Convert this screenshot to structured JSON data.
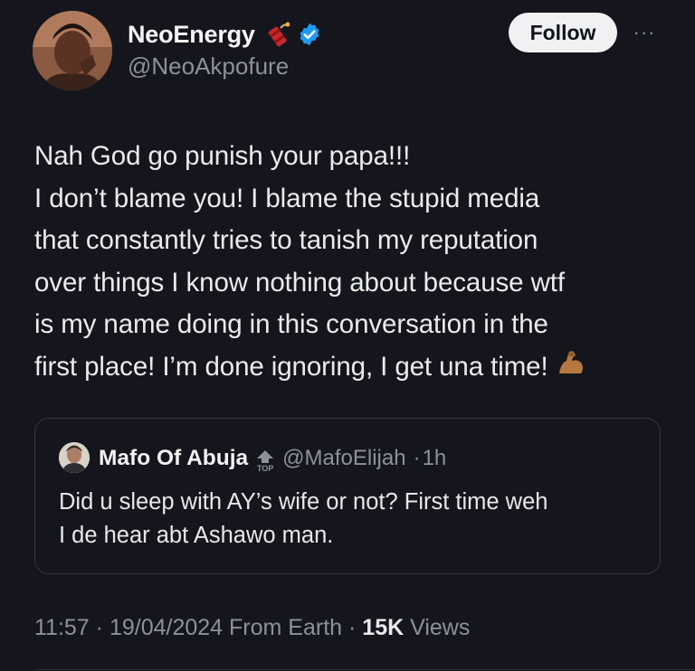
{
  "author": {
    "display_name": "NeoEnergy",
    "handle": "@NeoAkpofure"
  },
  "actions": {
    "follow_label": "Follow",
    "more_label": "···"
  },
  "tweet": {
    "lines": [
      "Nah God go punish your papa!!!",
      "I don’t blame you! I blame the stupid media",
      "that constantly tries to tanish my reputation",
      "over things I know nothing about because wtf",
      "is my name doing in this conversation in the",
      "first place! I’m done ignoring, I get una time!"
    ],
    "trailing_emoji": "💪🏽"
  },
  "quote": {
    "display_name": "Mafo Of Abuja",
    "badge_label": "TOP",
    "handle": "@MafoElijah",
    "separator": "·",
    "time": "1h",
    "lines": [
      "Did u sleep with AY’s wife or not? First time weh",
      "I de hear abt Ashawo man."
    ]
  },
  "meta": {
    "time": "11:57",
    "date": "19/04/2024",
    "source": "From Earth",
    "separator": "·",
    "views_count": "15K",
    "views_label": "Views"
  },
  "colors": {
    "background": "#15161d",
    "verified": "#1d9bf0",
    "muted": "#8b9299"
  }
}
